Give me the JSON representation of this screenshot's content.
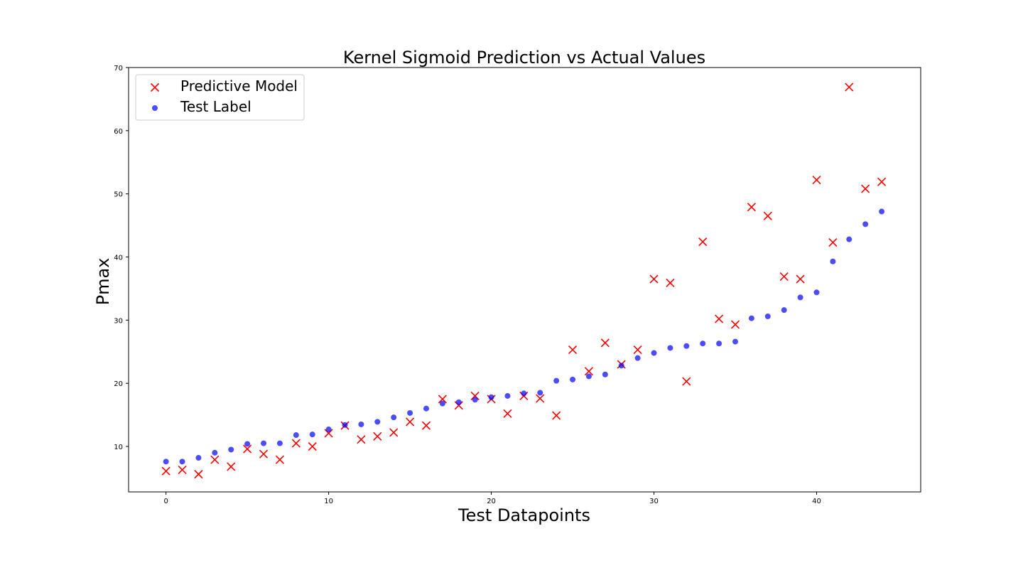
{
  "chart_data": {
    "type": "scatter",
    "title": "Kernel Sigmoid Prediction vs Actual Values",
    "xlabel": "Test Datapoints",
    "ylabel": "Pmax",
    "xlim": [
      -2.3,
      46.4
    ],
    "ylim": [
      2.8,
      70
    ],
    "xticks": [
      0,
      10,
      20,
      30,
      40
    ],
    "yticks": [
      10,
      20,
      30,
      40,
      50,
      60,
      70
    ],
    "grid": false,
    "legend_position": "top-left",
    "x": [
      0,
      1,
      2,
      3,
      4,
      5,
      6,
      7,
      8,
      9,
      10,
      11,
      12,
      13,
      14,
      15,
      16,
      17,
      18,
      19,
      20,
      21,
      22,
      23,
      24,
      25,
      26,
      27,
      28,
      29,
      30,
      31,
      32,
      33,
      34,
      35,
      36,
      37,
      38,
      39,
      40,
      41,
      42,
      43,
      44
    ],
    "series": [
      {
        "name": "Predictive Model",
        "marker": "x",
        "color": "#ff0000",
        "values": [
          6.1,
          6.3,
          5.6,
          7.9,
          6.8,
          9.6,
          8.8,
          7.9,
          10.5,
          10.0,
          12.1,
          13.3,
          11.1,
          11.6,
          12.2,
          13.9,
          13.3,
          17.5,
          16.5,
          18.0,
          17.5,
          15.2,
          18.0,
          17.6,
          14.9,
          25.3,
          21.9,
          26.4,
          23.0,
          25.3,
          36.5,
          35.9,
          20.3,
          42.4,
          30.2,
          29.3,
          47.9,
          46.5,
          36.9,
          36.5,
          52.2,
          42.3,
          66.9,
          50.8,
          51.9
        ]
      },
      {
        "name": "Test Label",
        "marker": "o",
        "color": "#0000ff",
        "alpha": 0.7,
        "values": [
          7.6,
          7.6,
          8.2,
          9.0,
          9.5,
          10.4,
          10.5,
          10.5,
          11.8,
          11.9,
          12.7,
          13.4,
          13.5,
          13.9,
          14.6,
          15.3,
          16.0,
          16.8,
          17.0,
          17.4,
          17.8,
          18.0,
          18.4,
          18.5,
          20.4,
          20.6,
          21.1,
          21.4,
          22.8,
          24.0,
          24.8,
          25.6,
          25.9,
          26.3,
          26.3,
          26.6,
          30.3,
          30.6,
          31.6,
          33.6,
          34.4,
          39.3,
          42.8,
          45.2,
          47.2
        ]
      }
    ]
  }
}
